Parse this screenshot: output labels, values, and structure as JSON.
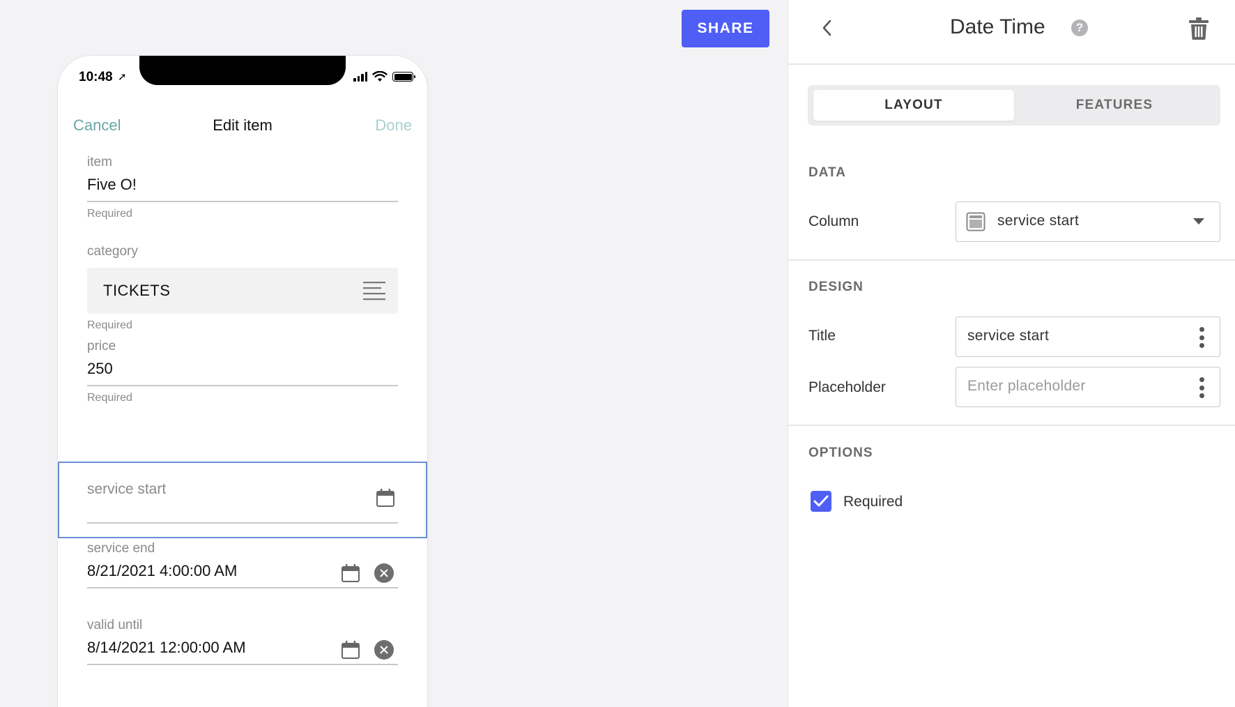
{
  "toolbar": {
    "share_label": "SHARE"
  },
  "phone": {
    "status": {
      "time": "10:48",
      "location_arrow": "➚"
    },
    "nav": {
      "cancel": "Cancel",
      "title": "Edit item",
      "done": "Done"
    },
    "fields": {
      "item": {
        "label": "item",
        "value": "Five O!",
        "hint": "Required"
      },
      "category": {
        "label": "category",
        "value": "TICKETS",
        "hint": "Required"
      },
      "price": {
        "label": "price",
        "value": "250",
        "hint": "Required"
      },
      "service_start": {
        "placeholder": "service start"
      },
      "service_end": {
        "label": "service end",
        "value": "8/21/2021 4:00:00 AM"
      },
      "valid_until": {
        "label": "valid until",
        "value": "8/14/2021 12:00:00 AM"
      }
    }
  },
  "panel": {
    "title": "Date Time",
    "help": "?",
    "tabs": [
      {
        "label": "LAYOUT",
        "active": true
      },
      {
        "label": "FEATURES",
        "active": false
      }
    ],
    "data_section": {
      "title": "DATA",
      "column_label": "Column",
      "column_value": "service start"
    },
    "design_section": {
      "title": "DESIGN",
      "title_label": "Title",
      "title_value": "service start",
      "placeholder_label": "Placeholder",
      "placeholder_hint": "Enter placeholder"
    },
    "options_section": {
      "title": "OPTIONS",
      "required_label": "Required",
      "required_checked": true
    }
  },
  "colors": {
    "accent": "#4f5ef5",
    "focus_border": "#6b8fd6",
    "cancel_teal": "#6aa6a6",
    "done_disabled": "#a9cfd0"
  }
}
